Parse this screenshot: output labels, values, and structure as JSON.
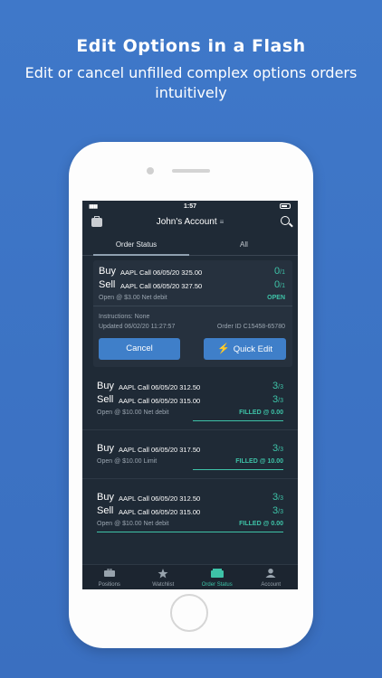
{
  "promo": {
    "headline": "Edit Options in a Flash",
    "subtitle": "Edit or cancel unfilled complex options orders intuitively"
  },
  "status_bar": {
    "time": "1:57"
  },
  "nav": {
    "account_title": "John's Account",
    "menu_glyph": "≡"
  },
  "tabs": [
    {
      "label": "Order Status",
      "active": true
    },
    {
      "label": "All",
      "active": false
    }
  ],
  "expanded_order": {
    "legs": [
      {
        "side": "Buy",
        "desc": "AAPL Call 06/05/20 325.00",
        "filled": "0",
        "total": "/1"
      },
      {
        "side": "Sell",
        "desc": "AAPL Call 06/05/20 327.50",
        "filled": "0",
        "total": "/1"
      }
    ],
    "price_note": "Open @ $3.00 Net debit",
    "status": "OPEN",
    "instructions": "Instructions: None",
    "updated": "Updated 06/02/20 11:27:57",
    "order_id": "Order ID C15458-65780",
    "cancel_label": "Cancel",
    "quick_edit_label": "Quick Edit"
  },
  "orders": [
    {
      "legs": [
        {
          "side": "Buy",
          "desc": "AAPL Call 06/05/20 312.50",
          "filled": "3",
          "total": "/3"
        },
        {
          "side": "Sell",
          "desc": "AAPL Call 06/05/20 315.00",
          "filled": "3",
          "total": "/3"
        }
      ],
      "price_note": "Open @ $10.00 Net debit",
      "status": "FILLED @ 0.00"
    },
    {
      "legs": [
        {
          "side": "Buy",
          "desc": "AAPL Call 06/05/20 317.50",
          "filled": "3",
          "total": "/3"
        }
      ],
      "price_note": "Open @ $10.00 Limit",
      "status": "FILLED @ 10.00"
    },
    {
      "legs": [
        {
          "side": "Buy",
          "desc": "AAPL Call 06/05/20 312.50",
          "filled": "3",
          "total": "/3"
        },
        {
          "side": "Sell",
          "desc": "AAPL Call 06/05/20 315.00",
          "filled": "3",
          "total": "/3"
        }
      ],
      "price_note": "Open @ $10.00 Net debit",
      "status": "FILLED @ 0.00"
    }
  ],
  "bottom_nav": [
    {
      "label": "Positions",
      "icon": "briefcase-icon"
    },
    {
      "label": "Watchlist",
      "icon": "star-icon"
    },
    {
      "label": "Order Status",
      "icon": "order-status-icon",
      "active": true
    },
    {
      "label": "Account",
      "icon": "person-icon"
    }
  ],
  "colors": {
    "accent_green": "#3ec3a8",
    "button_blue": "#3f7fc9",
    "screen_bg": "#1f2a36",
    "background_blue": "#3f78c9"
  }
}
